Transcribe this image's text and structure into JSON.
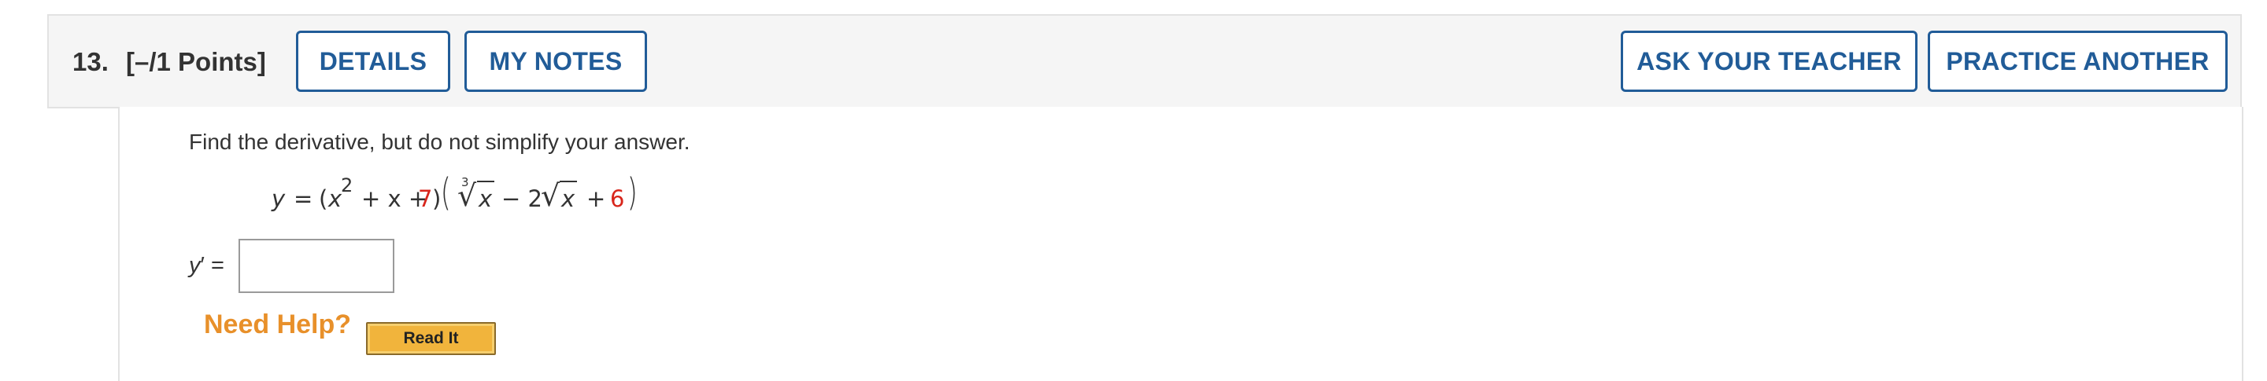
{
  "question": {
    "number": "13.",
    "points": "[–/1 Points]",
    "buttons": {
      "details": "DETAILS",
      "my_notes": "MY NOTES",
      "ask_teacher": "ASK YOUR TEACHER",
      "practice_another": "PRACTICE ANOTHER"
    },
    "prompt": "Find the derivative, but do not simplify your answer.",
    "equation": {
      "lhs": "y",
      "equals": "=",
      "open1": "(",
      "x1": "x",
      "exp2": "2",
      "plus_x": "+ x +",
      "const1": "7",
      "close1": ")",
      "open2": "(",
      "root_index": "3",
      "radical": "√",
      "x2": "x",
      "minus_2": "− 2",
      "x3": "x",
      "plus": "+",
      "const2": "6",
      "close2": ")"
    },
    "answer_label_var": "y",
    "answer_label_rest": "′ =",
    "answer_value": "",
    "help": {
      "label": "Need Help?",
      "read_it": "Read It"
    },
    "colors": {
      "button_border": "#215c98",
      "highlight_red": "#d8261c",
      "help_orange": "#e8902a",
      "read_it_fill": "#f1b43c"
    }
  }
}
